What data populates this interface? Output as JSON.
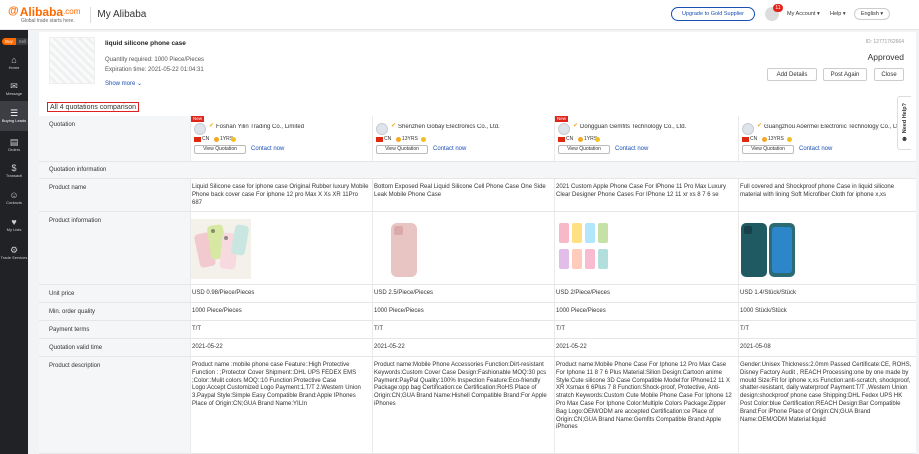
{
  "header": {
    "logo_glyph": "@",
    "logo_text": "Alibaba",
    "logo_domain": ".com",
    "logo_tagline": "Global trade starts here.",
    "section_title": "My Alibaba",
    "upgrade_label": "Upgrade to Gold Supplier",
    "notification_count": "11",
    "account_label": "My Account ▾",
    "help_label": "Help ▾",
    "language_label": "English ▾"
  },
  "sidebar": {
    "buy_label": "Buy",
    "sell_label": "Sell",
    "items": [
      {
        "label": "Home",
        "icon": "⌂"
      },
      {
        "label": "Message",
        "icon": "✉"
      },
      {
        "label": "Buying Leads",
        "icon": "☰"
      },
      {
        "label": "Orders",
        "icon": "▤"
      },
      {
        "label": "Transacti",
        "icon": "$"
      },
      {
        "label": "Contacts",
        "icon": "☺"
      },
      {
        "label": "My Lists",
        "icon": "♥"
      },
      {
        "label": "Trade Services",
        "icon": "⚙"
      }
    ]
  },
  "rfq": {
    "title": "liquid silicone phone case",
    "quantity": "Quantity required: 1000 Piece/Pieces",
    "expiration": "Expiration time: 2021-05-22 01:04:31",
    "show_more": "Show more ⌄",
    "id": "ID: 12771762664",
    "status": "Approved",
    "buttons": {
      "add_details": "Add Details",
      "post_again": "Post Again",
      "close": "Close"
    }
  },
  "comparison": {
    "title": "All 4 quotations comparison",
    "labels": {
      "quotation": "Quotation",
      "quotation_information": "Quotation information",
      "product_name": "Product name",
      "product_information": "Product information",
      "unit_price": "Unit price",
      "min_order": "Min. order quality",
      "payment_terms": "Payment terms",
      "valid_time": "Quotation valid time",
      "description": "Product description"
    },
    "view_quotation": "View Quotation",
    "contact_now": "Contact now",
    "new_badge": "New",
    "country": "CN",
    "suppliers": [
      {
        "name": "Foshan Yilin Trading Co., Limited",
        "years": "1YRS",
        "is_new": true,
        "product_name": "Liquid Silicone case for iphone case Original Rubber luxury Mobile Phone back cover case For iphone 12 pro Max X Xs XR 11Pro 687",
        "unit_price": "USD 0.98/Piece/Pieces",
        "min_order": "1000 Piece/Pieces",
        "payment_terms": "T/T",
        "valid_time": "2021-05-22",
        "description": "Product name :mobile phone case Feature::High Protective Function : ;Protector Cover Shipment::DHL UPS FEDEX EMS ;Color::Mulit colors MOQ::10 Function:Protective Case Logo:Accept Customized Logo Payment:1.T/T 2.Western Union 3.Paypal Style:Simple Easy Compatible Brand:Apple IPhones Place of Origin:CN;GUA Brand Name:YILIn"
      },
      {
        "name": "Shenzhen Gobay Electronics Co., Ltd.",
        "years": "13YRS",
        "is_new": false,
        "product_name": "Bottom Exposed Real Liquid Silicone Cell Phone Case One Side Leak Mobile Phone Case",
        "unit_price": "USD 2.5/Piece/Pieces",
        "min_order": "1000 Piece/Pieces",
        "payment_terms": "T/T",
        "valid_time": "2021-05-22",
        "description": "Product name:Mobile Phone Accessories Function:Dirt-resistant Keywords:Custom Cover Case Design:Fashionable MOQ:30 pcs Payment:PayPal Quality:100% Inspection Feature:Eco-friendly Package:opp bag Certification:ce Certification:RoHS Place of Origin:CN;GUA Brand Name:Hishell Compatible Brand:For Apple iPhones"
      },
      {
        "name": "Dongguan Gemfits Technology Co., Ltd.",
        "years": "1YRS",
        "is_new": true,
        "product_name": "2021 Custom Apple Phone Case For IPhone 11 Pro Max Luxury Clear Designer Phone Cases For IPhone 12 11 xr xs 8 7 6 se",
        "unit_price": "USD 2/Piece/Pieces",
        "min_order": "1000 Piece/Pieces",
        "payment_terms": "T/T",
        "valid_time": "2021-05-22",
        "description": "Product name:Mobile Phone Case For Iphone 12 Pro Max Case For Iphone 11 8 7 6 Plus Material:Silion Design:Cartoon anime Style:Cute silicone 3D Case Compatible Model:for IPhone12 11 X XR Xsmax 6 6Plus 7 8 Function:Shock-proof, Protective, Anti-stratch Keywords:Custom Cute Mobile Phone Case For Iphone 12 Pro Max Case For Iphone Color:Multiple Colors Package:Zipper Bag Logo:OEM/ODM are accepted Certification:ce Place of Origin:CN;GUA Brand Name:Gemfits Compatible Brand:Apple iPhones"
      },
      {
        "name": "Guangzhou Aoermei Electronic Technology Co., Ltd.",
        "years": "13YRS",
        "is_new": false,
        "product_name": "Full covered and Shockproof phone Case in liquid silicone material with lining Soft Microfiber Cloth for iphone x,xs",
        "unit_price": "USD 1.4/Stück/Stück",
        "min_order": "1000 Stück/Stück",
        "payment_terms": "T/T",
        "valid_time": "2021-05-08",
        "description": "Gender:Unisex Thickness:2.0mm Passed Certificate:CE, ROHS, Disney Factory Audit , REACH Processing:one by one made by mould Size:Fit for iphone x,xs Function:anti-scratch, shockproof, shatter-resistant, daily waterproof Payment:T/T ,Western Union design:shockproof phone case Shipping:DHL Fedex UPS HK Post Color:blue Certification:REACH Design:Bar Compatible Brand:For iPhone Place of Origin:CN;GUA Brand Name:OEM/ODM Material:liquid"
      }
    ]
  },
  "help_tab": {
    "label": "Need Help?"
  }
}
